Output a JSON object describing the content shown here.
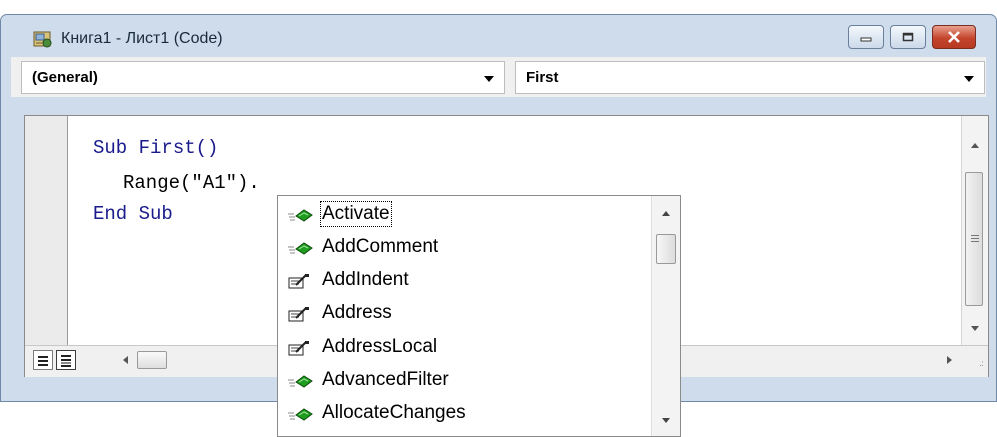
{
  "window": {
    "title": "Книга1 - Лист1 (Code)",
    "icon": "vba-module-icon",
    "controls": [
      "minimize-icon",
      "maximize-icon",
      "close-icon"
    ]
  },
  "combos": {
    "object": "(General)",
    "procedure": "First"
  },
  "code": {
    "line1_keyword": "Sub",
    "line1_rest": " First()",
    "line2": "Range(\"A1\").",
    "line3": "End Sub"
  },
  "autocomplete": {
    "items": [
      {
        "label": "Activate",
        "icon": "method-icon"
      },
      {
        "label": "AddComment",
        "icon": "method-icon"
      },
      {
        "label": "AddIndent",
        "icon": "property-icon"
      },
      {
        "label": "Address",
        "icon": "property-icon"
      },
      {
        "label": "AddressLocal",
        "icon": "property-icon"
      },
      {
        "label": "AdvancedFilter",
        "icon": "method-icon"
      },
      {
        "label": "AllocateChanges",
        "icon": "method-icon"
      }
    ],
    "selected": "Activate"
  },
  "colors": {
    "keyword": "#1a1a8c",
    "method_icon": "#1f9d1f",
    "close_button": "#c4452d"
  }
}
